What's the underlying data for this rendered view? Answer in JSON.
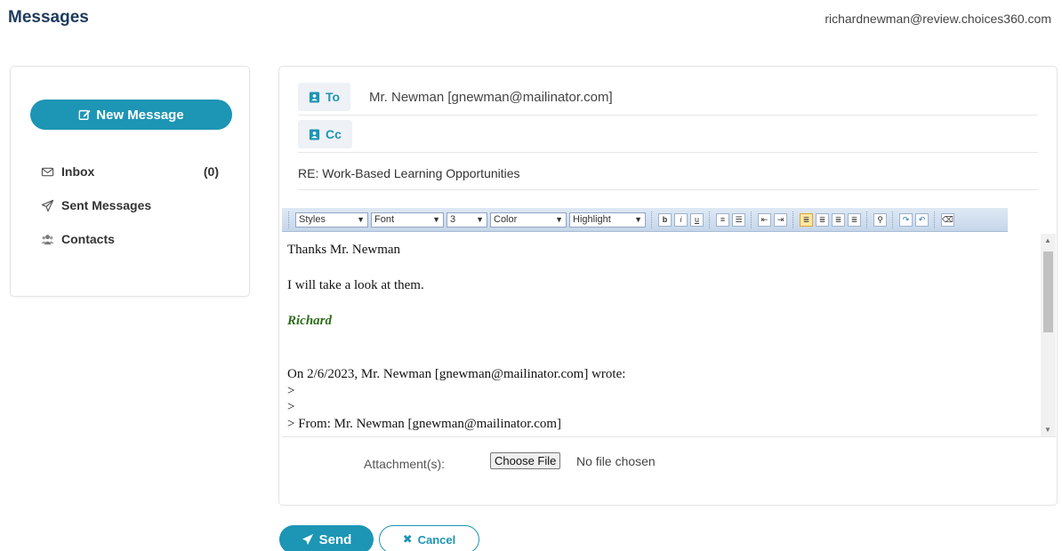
{
  "header": {
    "title": "Messages",
    "user_email": "richardnewman@review.choices360.com"
  },
  "sidebar": {
    "new_message_label": "New Message",
    "items": [
      {
        "label": "Inbox",
        "count": "(0)",
        "icon": "envelope-icon"
      },
      {
        "label": "Sent Messages",
        "icon": "paper-plane-icon"
      },
      {
        "label": "Contacts",
        "icon": "users-icon"
      }
    ]
  },
  "compose": {
    "to_label": "To",
    "to_value": "Mr. Newman [gnewman@mailinator.com]",
    "cc_label": "Cc",
    "subject": "RE: Work-Based Learning Opportunities",
    "toolbar": {
      "styles": "Styles",
      "font": "Font",
      "size": "3",
      "color": "Color",
      "highlight": "Highlight"
    },
    "body_lines": [
      "Thanks Mr. Newman",
      "I will take a look at them.",
      "Richard",
      "On 2/6/2023, Mr. Newman [gnewman@mailinator.com] wrote:",
      ">",
      ">",
      "> From: Mr. Newman [gnewman@mailinator.com]"
    ],
    "attachment_label": "Attachment(s):",
    "choose_file_label": "Choose File",
    "file_status": "No file chosen"
  },
  "actions": {
    "send_label": "Send",
    "cancel_label": "Cancel"
  },
  "colors": {
    "accent": "#1d95b4",
    "title": "#1d3a5c",
    "signature": "#2e6a1a"
  }
}
